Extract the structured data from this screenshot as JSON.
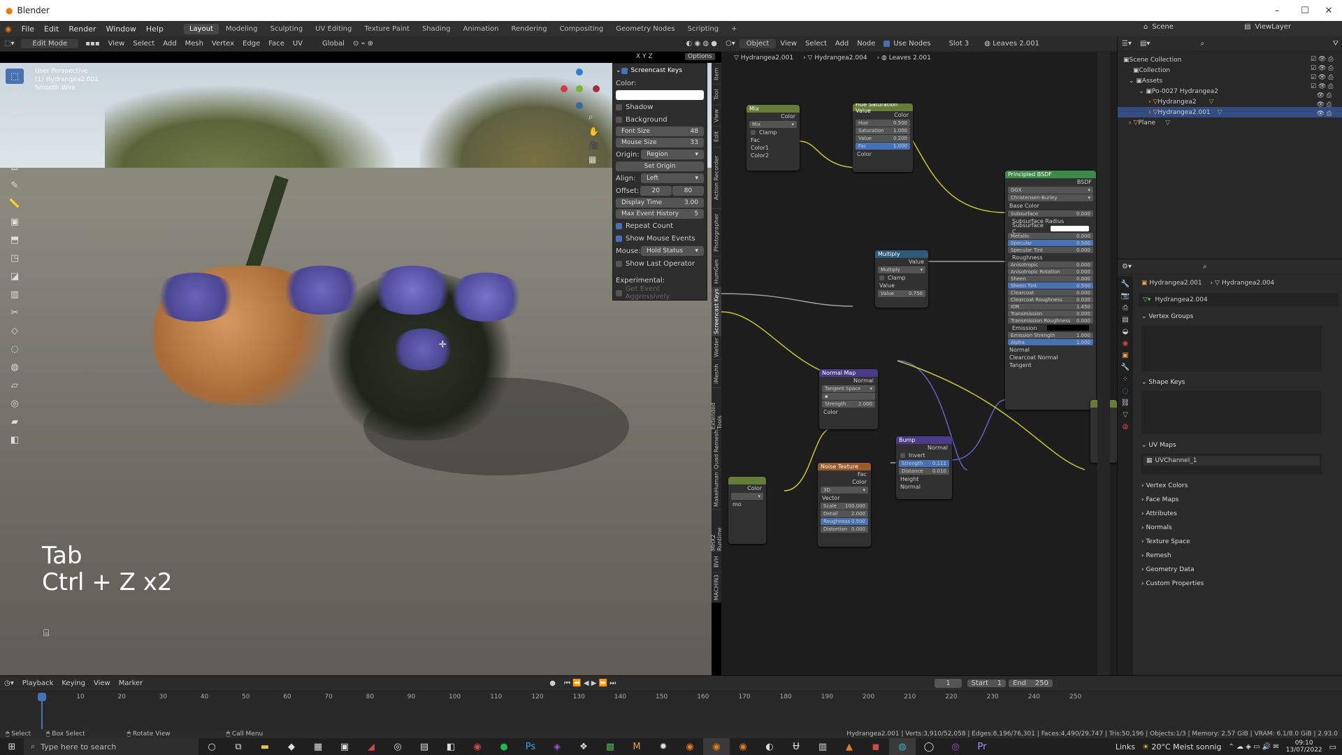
{
  "window": {
    "title": "Blender",
    "controls": {
      "minimize": "–",
      "maximize": "☐",
      "close": "✕"
    }
  },
  "menus": [
    "File",
    "Edit",
    "Render",
    "Window",
    "Help"
  ],
  "workspaces": [
    "Layout",
    "Modeling",
    "Sculpting",
    "UV Editing",
    "Texture Paint",
    "Shading",
    "Animation",
    "Rendering",
    "Compositing",
    "Geometry Nodes",
    "Scripting",
    "+"
  ],
  "topbar": {
    "scene": "Scene",
    "view_layer": "ViewLayer"
  },
  "viewport_header": {
    "mode": "Edit Mode",
    "menus": [
      "View",
      "Select",
      "Add",
      "Mesh",
      "Vertex",
      "Edge",
      "Face",
      "UV"
    ],
    "orientation": "Global",
    "options": "Options",
    "axes": [
      "X",
      "Y",
      "Z"
    ]
  },
  "viewport": {
    "info": [
      "User Perspective",
      "(1) Hydrangea2.001",
      "Smooth Wire"
    ],
    "key_overlay": {
      "line1": "Tab",
      "line2": "Ctrl + Z x2"
    }
  },
  "screencast": {
    "title": "Screencast Keys",
    "color_label": "Color:",
    "shadow": "Shadow",
    "background": "Background",
    "font_size_label": "Font Size",
    "font_size": "48",
    "mouse_size_label": "Mouse Size",
    "mouse_size": "33",
    "origin_label": "Origin:",
    "origin": "Region",
    "set_origin": "Set Origin",
    "align_label": "Align:",
    "align": "Left",
    "offset_label": "Offset:",
    "offset_x": "20",
    "offset_y": "80",
    "display_time_label": "Display Time",
    "display_time": "3.00",
    "max_history_label": "Max Event History",
    "max_history": "5",
    "repeat_count": "Repeat Count",
    "show_mouse_events": "Show Mouse Events",
    "mouse_label": "Mouse:",
    "mouse": "Hold Status",
    "show_last_operator": "Show Last Operator",
    "experimental": "Experimental:",
    "get_event": "Get Event Aggressively"
  },
  "side_tabs": [
    "Item",
    "Tool",
    "View",
    "Edit",
    "Action Recorder",
    "Photographer",
    "HumGen",
    "Screencast Keys",
    "Welder",
    "iMeshh",
    "Extended Tools",
    "Quad Remesh",
    "MakeHuman",
    "MHX2 Runtime",
    "BVH",
    "MACHIN3"
  ],
  "node_header": {
    "type": "Object",
    "menus": [
      "View",
      "Select",
      "Add",
      "Node"
    ],
    "use_nodes": "Use Nodes",
    "slot": "Slot 3",
    "material": "Leaves 2.001"
  },
  "node_breadcrumb": [
    "Hydrangea2.001",
    "Hydrangea2.004",
    "Leaves 2.001"
  ],
  "nodes": {
    "mix": {
      "title": "Mix",
      "out": "Color",
      "mode": "Mix",
      "clamp": "Clamp",
      "in": [
        "Fac",
        "Color1",
        "Color2"
      ]
    },
    "hsv": {
      "title": "Hue Saturation Value",
      "out": "Color",
      "fields": [
        [
          "Hue",
          "0.500"
        ],
        [
          "Saturation",
          "1.000"
        ],
        [
          "Value",
          "0.200"
        ],
        [
          "Fac",
          "1.000"
        ]
      ],
      "in": "Color"
    },
    "principled": {
      "title": "Principled BSDF",
      "out": "BSDF",
      "dist": "GGX",
      "sss": "Christensen-Burley",
      "base": "Base Color",
      "fields": [
        [
          "Subsurface",
          "0.000"
        ],
        [
          "Subsurface Radius",
          ""
        ],
        [
          "Subsurface C...",
          ""
        ],
        [
          "Metallic",
          "0.000"
        ],
        [
          "Specular",
          "0.500"
        ],
        [
          "Specular Tint",
          "0.000"
        ],
        [
          "Roughness",
          ""
        ],
        [
          "Anisotropic",
          "0.000"
        ],
        [
          "Anisotropic Rotation",
          "0.000"
        ],
        [
          "Sheen",
          "0.000"
        ],
        [
          "Sheen Tint",
          "0.500"
        ],
        [
          "Clearcoat",
          "0.000"
        ],
        [
          "Clearcoat Roughness",
          "0.030"
        ],
        [
          "IOR",
          "1.450"
        ],
        [
          "Transmission",
          "0.000"
        ],
        [
          "Transmission Roughness",
          "0.000"
        ],
        [
          "Emission",
          ""
        ],
        [
          "Emission Strength",
          "1.000"
        ],
        [
          "Alpha",
          "1.000"
        ]
      ],
      "tail": [
        "Normal",
        "Clearcoat Normal",
        "Tangent"
      ]
    },
    "multiply": {
      "title": "Multiply",
      "out": "Value",
      "mode": "Multiply",
      "clamp": "Clamp",
      "in": "Value",
      "value": "0.750"
    },
    "normal_map": {
      "title": "Normal Map",
      "out": "Normal",
      "space": "Tangent Space",
      "strength": "2.000",
      "in": "Color"
    },
    "bump": {
      "title": "Bump",
      "out": "Normal",
      "invert": "Invert",
      "strength": "0.111",
      "distance": "0.010",
      "in": [
        "Height",
        "Normal"
      ]
    },
    "noise": {
      "title": "Noise Texture",
      "outs": [
        "Fac",
        "Color"
      ],
      "dim": "3D",
      "vector": "Vector",
      "fields": [
        [
          "Scale",
          "100.000"
        ],
        [
          "Detail",
          "2.000"
        ],
        [
          "Roughness",
          "0.500"
        ],
        [
          "Distortion",
          "0.000"
        ]
      ]
    },
    "color_node": {
      "out": "Color",
      "label": "mo"
    }
  },
  "outliner": {
    "items": [
      "Scene Collection",
      "Collection",
      "Assets",
      "Po-0027 Hydrangea2",
      "Hydrangea2",
      "Hydrangea2.001",
      "Plane"
    ]
  },
  "properties": {
    "object": "Hydrangea2.001",
    "mesh": "Hydrangea2.004",
    "datablock": "Hydrangea2.004",
    "sections": [
      "Vertex Groups",
      "Shape Keys",
      "UV Maps"
    ],
    "uv_channel": "UVChannel_1",
    "collapsed": [
      "Vertex Colors",
      "Face Maps",
      "Attributes",
      "Normals",
      "Texture Space",
      "Remesh",
      "Geometry Data",
      "Custom Properties"
    ]
  },
  "timeline": {
    "menus": [
      "Playback",
      "Keying",
      "View",
      "Marker"
    ],
    "frame": "1",
    "start_label": "Start",
    "start": "1",
    "end_label": "End",
    "end": "250",
    "ticks": [
      "1",
      "10",
      "20",
      "30",
      "40",
      "50",
      "60",
      "70",
      "80",
      "90",
      "100",
      "110",
      "120",
      "130",
      "140",
      "150",
      "160",
      "170",
      "180",
      "190",
      "200",
      "210",
      "220",
      "230",
      "240",
      "250"
    ]
  },
  "statusbar": {
    "left": [
      "Select",
      "Box Select",
      "Rotate View",
      "Call Menu"
    ],
    "right": "Hydrangea2.001 | Verts:3,910/52,058 | Edges:8,196/76,301 | Faces:4,490/29,747 | Tris:50,196 | Objects:1/3 | Memory: 2.57 GiB | VRAM: 6.1/8.0 GiB | 2.93.0"
  },
  "taskbar": {
    "search": "Type here to search",
    "links": "Links",
    "weather": "20°C Meist sonnig",
    "time": "09:10",
    "date": "13/07/2022"
  }
}
